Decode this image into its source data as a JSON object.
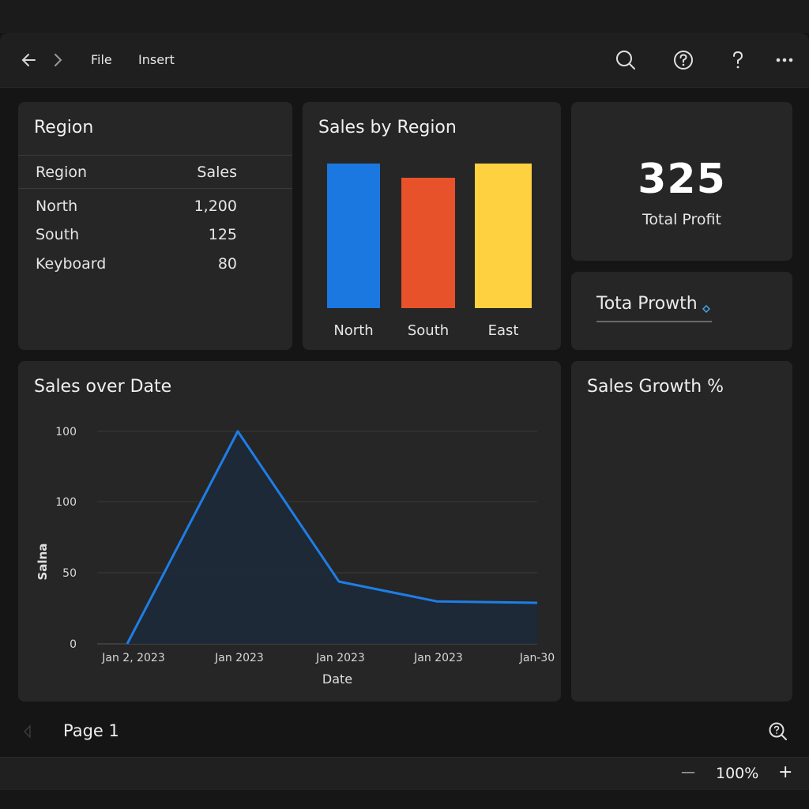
{
  "toolbar": {
    "menu": [
      "File",
      "Insert"
    ],
    "icons": [
      "back-arrow-icon",
      "forward-arrow-icon",
      "search-icon",
      "help-circle-icon",
      "question-icon",
      "more-icon"
    ]
  },
  "region_table": {
    "title": "Region",
    "headers": [
      "Region",
      "Sales"
    ],
    "rows": [
      {
        "region": "North",
        "sales": "1,200"
      },
      {
        "region": "South",
        "sales": "125"
      },
      {
        "region": "Keyboard",
        "sales": "80"
      }
    ]
  },
  "bar_chart": {
    "title": "Sales by Region"
  },
  "kpi": {
    "value": "325",
    "label": "Total Profit"
  },
  "growth_input": {
    "value": "Tota Prowth"
  },
  "line_chart": {
    "title": "Sales over Date",
    "ylabel": "Salna",
    "xlabel": "Date",
    "ytick_labels": [
      "100",
      "100",
      "50",
      "0"
    ],
    "xtick_labels": [
      "Jan 2, 2023",
      "Jan 2023",
      "Jan 2023",
      "Jan 2023",
      "Jan-30"
    ]
  },
  "growth_card": {
    "title": "Sales Growth %"
  },
  "pager": {
    "label": "Page 1"
  },
  "status": {
    "zoom": "100%",
    "zoom_out": "—",
    "zoom_in": "+"
  },
  "colors": {
    "line": "#1e7ee6",
    "north": "#1a78e0",
    "south": "#e8522a",
    "east": "#fdd13f"
  },
  "chart_data": [
    {
      "type": "bar",
      "title": "Sales by Region",
      "categories": [
        "North",
        "South",
        "East"
      ],
      "values": [
        100,
        90,
        100
      ],
      "colors": [
        "#1a78e0",
        "#e8522a",
        "#fdd13f"
      ],
      "ylim": [
        0,
        100
      ]
    },
    {
      "type": "area",
      "title": "Sales over Date",
      "xlabel": "Date",
      "ylabel": "Salna",
      "x": [
        "Jan 2, 2023",
        "Jan 2023",
        "Jan 2023",
        "Jan 2023",
        "Jan-30"
      ],
      "y": [
        0,
        150,
        44,
        30,
        29
      ],
      "ylim": [
        0,
        150
      ],
      "grid": true
    }
  ]
}
